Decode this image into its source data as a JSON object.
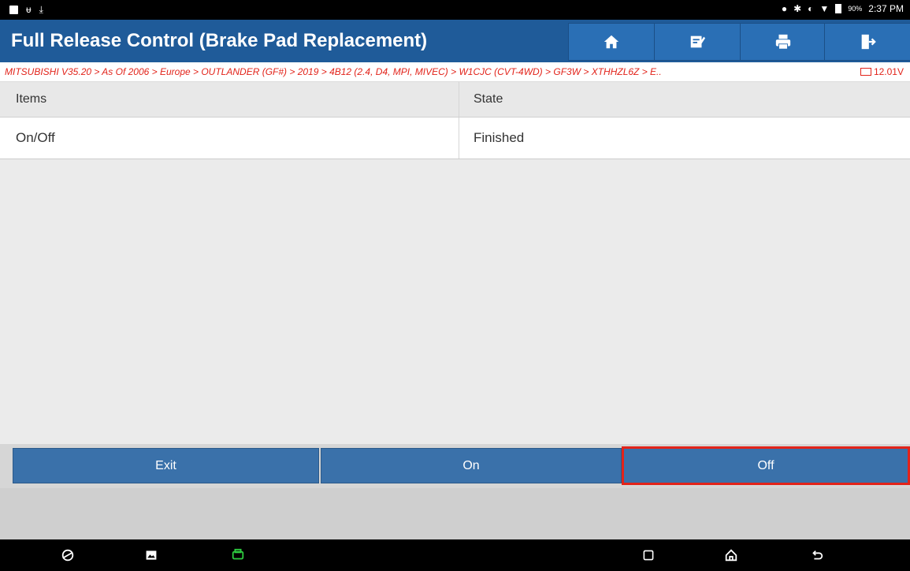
{
  "status_bar": {
    "left_icons": [
      "image-icon",
      "usb-icon",
      "download-icon"
    ],
    "right_icons": [
      "location-icon",
      "bluetooth-icon",
      "sync-icon",
      "wifi-icon",
      "battery-icon"
    ],
    "battery_text": "90%",
    "time": "2:37 PM"
  },
  "header": {
    "title": "Full Release Control (Brake Pad Replacement)",
    "buttons": [
      "home-icon",
      "edit-icon",
      "print-icon",
      "exit-icon"
    ]
  },
  "breadcrumb": {
    "path": "MITSUBISHI V35.20 > As Of 2006 > Europe > OUTLANDER (GF#) > 2019 > 4B12 (2.4, D4, MPI, MIVEC) > W1CJC (CVT-4WD) > GF3W > XTHHZL6Z > E..",
    "voltage": "12.01V"
  },
  "table": {
    "columns": [
      "Items",
      "State"
    ],
    "rows": [
      [
        "On/Off",
        "Finished"
      ]
    ]
  },
  "actions": {
    "exit": "Exit",
    "on": "On",
    "off": "Off"
  },
  "colors": {
    "header_bg": "#1f5b99",
    "button_bg": "#3a71aa",
    "breadcrumb_text": "#e2231a",
    "highlight": "#e2231a"
  }
}
